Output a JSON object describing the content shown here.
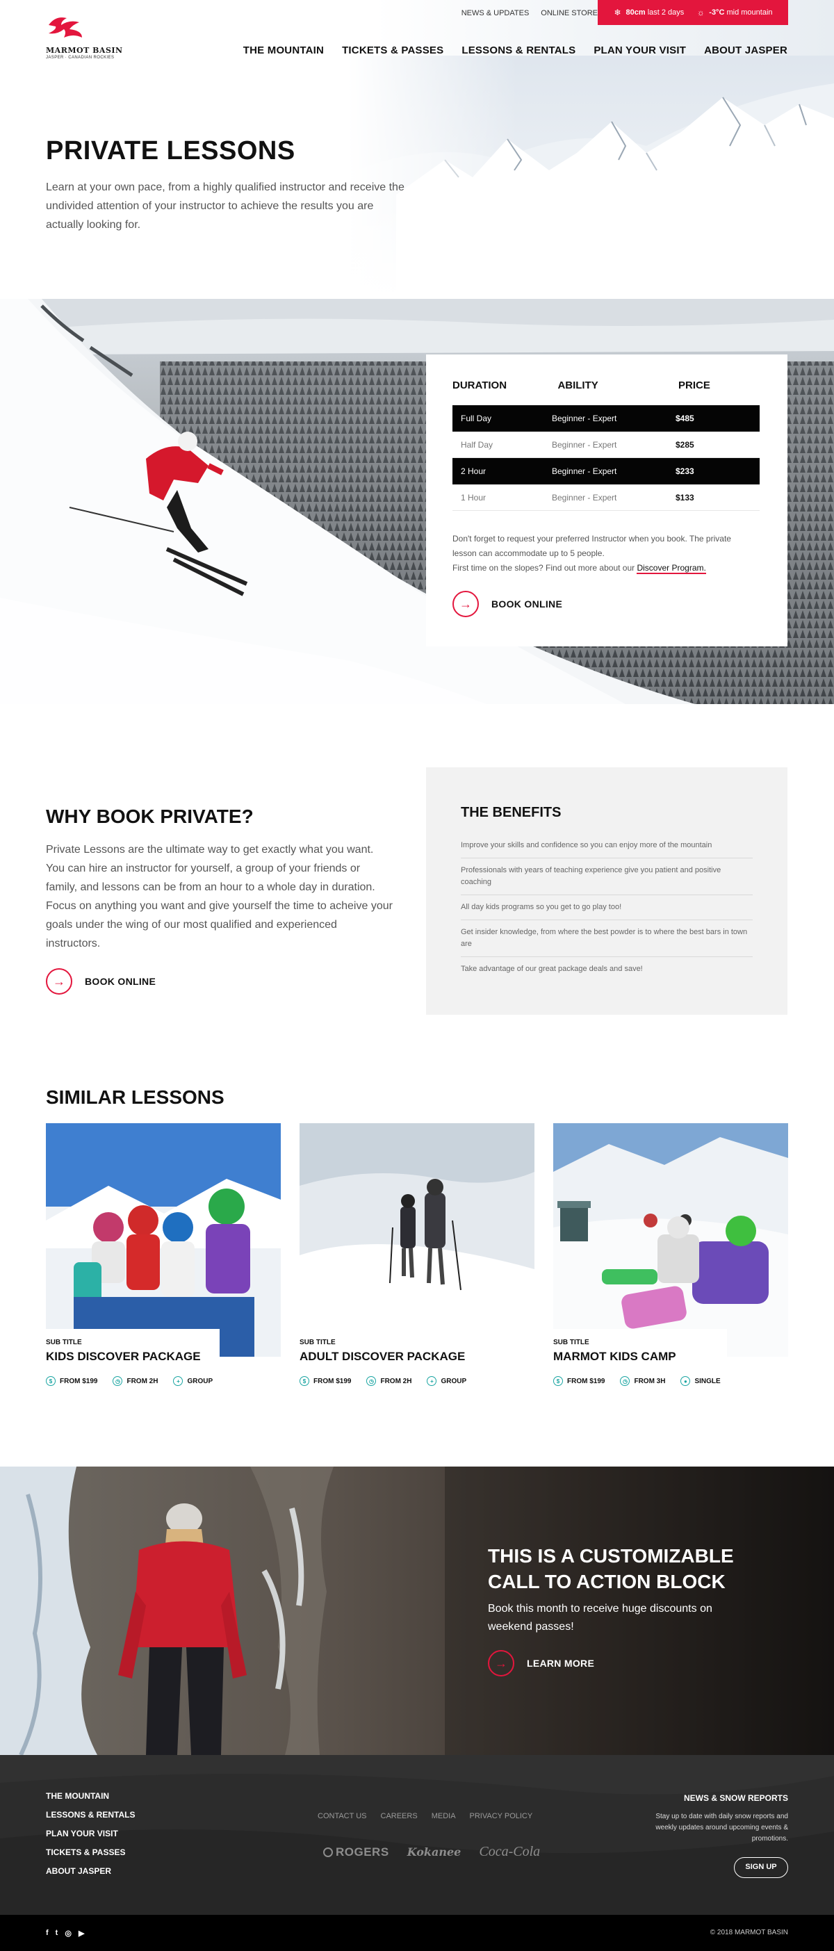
{
  "brand": {
    "name": "MARMOT BASIN",
    "tagline": "JASPER · CANADIAN ROCKIES",
    "accent_color": "#e3163d",
    "teal_color": "#1aa5a2"
  },
  "utility_nav": [
    "NEWS & UPDATES",
    "ONLINE STORE"
  ],
  "snow_report": {
    "snow_icon": "snowflake-icon",
    "snow_value": "80cm",
    "snow_text": "last 2 days",
    "temp_icon": "sun-icon",
    "temp_value": "-3°C",
    "temp_text": "mid mountain"
  },
  "main_nav": [
    "THE MOUNTAIN",
    "TICKETS & PASSES",
    "LESSONS & RENTALS",
    "PLAN YOUR VISIT",
    "ABOUT JASPER"
  ],
  "hero": {
    "title": "PRIVATE LESSONS",
    "text": "Learn at your own pace, from a highly qualified instructor and receive the undivided attention of your instructor to achieve the results you are actually looking for."
  },
  "pricing": {
    "headers": {
      "duration": "DURATION",
      "ability": "ABILITY",
      "price": "PRICE"
    },
    "rows": [
      {
        "duration": "Full Day",
        "ability": "Beginner - Expert",
        "price": "$485"
      },
      {
        "duration": "Half Day",
        "ability": "Beginner - Expert",
        "price": "$285"
      },
      {
        "duration": "2 Hour",
        "ability": "Beginner - Expert",
        "price": "$233"
      },
      {
        "duration": "1 Hour",
        "ability": "Beginner - Expert",
        "price": "$133"
      }
    ],
    "note_1": "Don't forget to request your preferred Instructor when you book. The private lesson can accommodate up to 5 people.",
    "note_2": "First time on the slopes? Find out more about our ",
    "note_link": "Discover Program.",
    "cta_label": "BOOK ONLINE"
  },
  "why": {
    "title": "WHY BOOK PRIVATE?",
    "text": "Private Lessons are the ultimate way to get exactly what you want. You can hire an instructor for yourself, a group of your friends or family, and lessons can be from an hour to a whole day in duration. Focus on anything you want and give yourself the time to acheive your goals under the wing of our most qualified and experienced instructors.",
    "cta_label": "BOOK ONLINE"
  },
  "benefits": {
    "title": "THE BENEFITS",
    "items": [
      "Improve your skills and confidence so you can enjoy more of the mountain",
      "Professionals with years of teaching experience give you patient and positive coaching",
      "All day kids programs so you get to go play too!",
      "Get insider knowledge, from where the best powder is to where the best bars in town are",
      "Take advantage of our great package deals and save!"
    ]
  },
  "similar": {
    "title": "SIMILAR LESSONS",
    "cards": [
      {
        "sub": "SUB TITLE",
        "title": "KIDS DISCOVER PACKAGE",
        "price": "FROM $199",
        "duration": "FROM 2H",
        "type": "GROUP",
        "type_icon": "plus-icon"
      },
      {
        "sub": "SUB TITLE",
        "title": "ADULT DISCOVER PACKAGE",
        "price": "FROM $199",
        "duration": "FROM 2H",
        "type": "GROUP",
        "type_icon": "plus-icon"
      },
      {
        "sub": "SUB TITLE",
        "title": "MARMOT KIDS CAMP",
        "price": "FROM $199",
        "duration": "FROM 3H",
        "type": "SINGLE",
        "type_icon": "person-icon"
      }
    ]
  },
  "cta_block": {
    "title": "THIS IS A CUSTOMIZABLE CALL TO ACTION BLOCK",
    "text": "Book this month to receive huge discounts on weekend passes!",
    "cta_label": "LEARN MORE"
  },
  "footer": {
    "nav": [
      "THE MOUNTAIN",
      "LESSONS & RENTALS",
      "PLAN YOUR VISIT",
      "TICKETS & PASSES",
      "ABOUT JASPER"
    ],
    "links": [
      "CONTACT US",
      "CAREERS",
      "MEDIA",
      "PRIVACY POLICY"
    ],
    "sponsors": [
      "ROGERS",
      "Kokanee",
      "Coca-Cola"
    ],
    "newsletter_title": "NEWS & SNOW REPORTS",
    "newsletter_text": "Stay up to date with daily snow reports and weekly updates around upcoming events & promotions.",
    "signup_label": "SIGN UP",
    "social": [
      "f",
      "t",
      "◎",
      "▶"
    ],
    "copyright": "© 2018 MARMOT BASIN"
  }
}
